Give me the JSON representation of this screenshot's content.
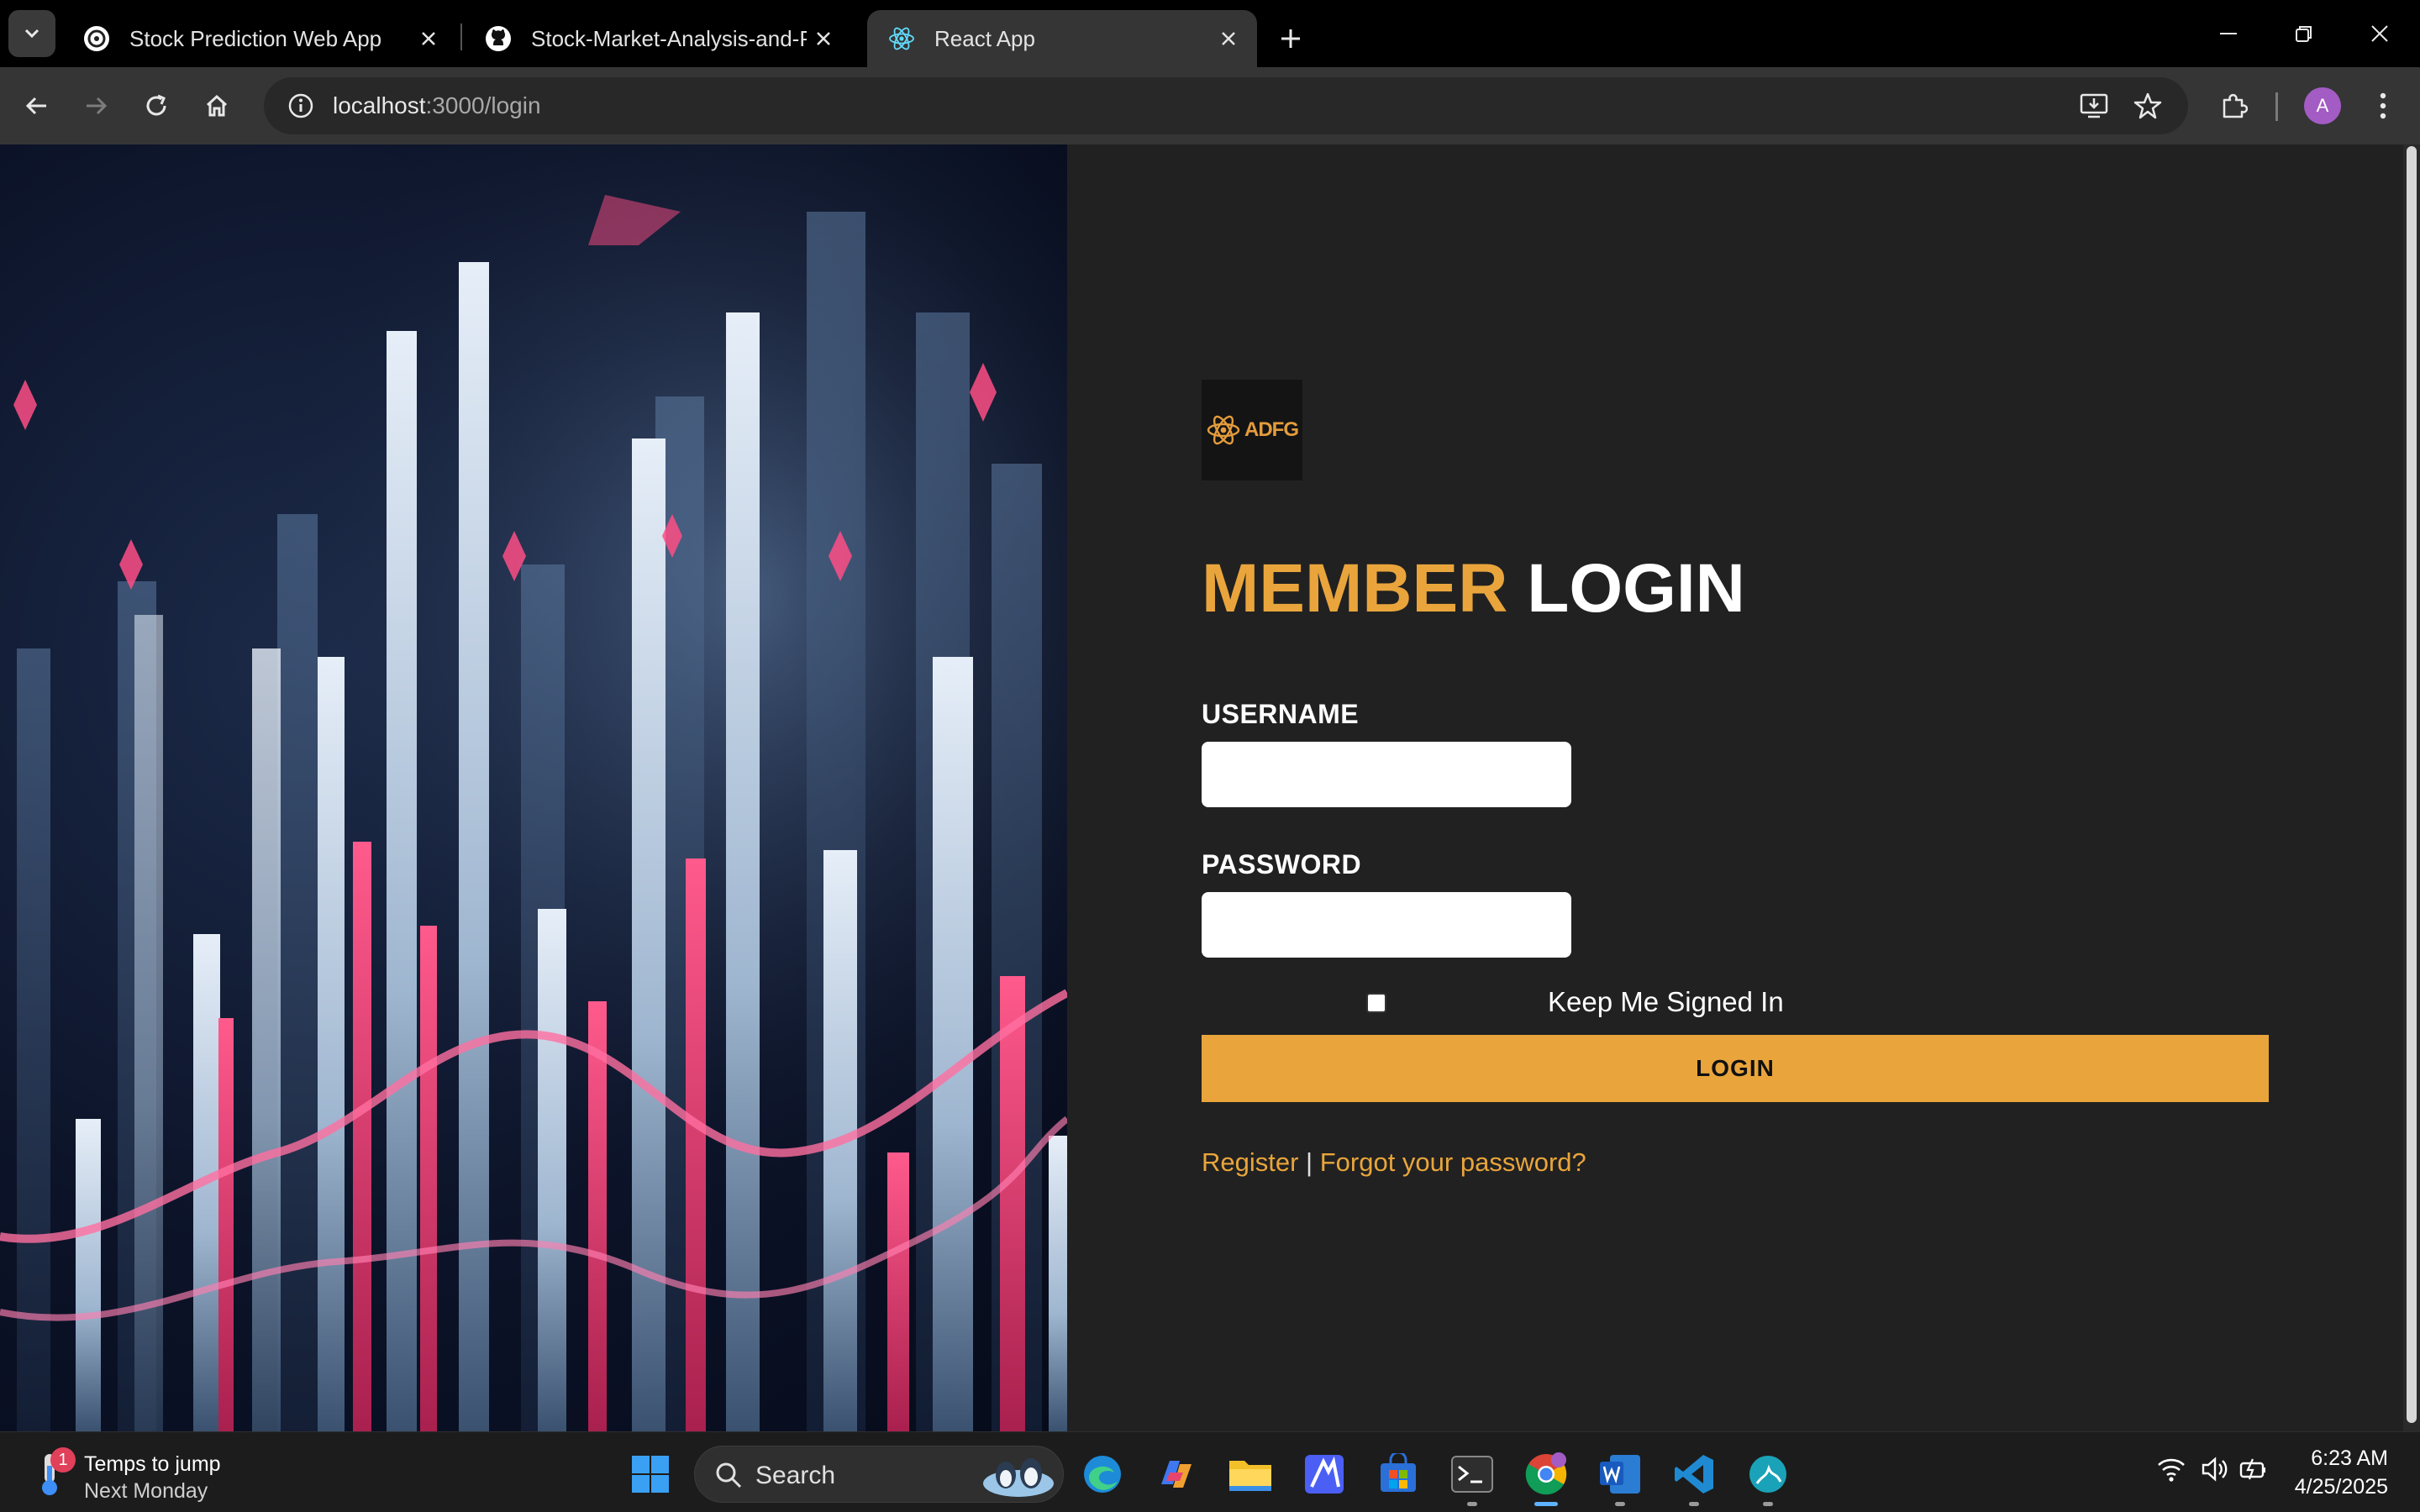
{
  "browser": {
    "tabs": [
      {
        "title": "Stock Prediction Web App",
        "icon": "chatgpt-icon"
      },
      {
        "title": "Stock-Market-Analysis-and-Pre",
        "icon": "github-icon"
      },
      {
        "title": "React App",
        "icon": "react-icon",
        "active": true
      }
    ],
    "address": {
      "host": "localhost",
      "path": ":3000/login"
    }
  },
  "profile": {
    "initial": "A"
  },
  "login": {
    "logo_text": "ADFG",
    "heading_word1": "MEMBER",
    "heading_word2": "LOGIN",
    "username_label": "USERNAME",
    "username_value": "",
    "password_label": "PASSWORD",
    "password_value": "",
    "remember_label": "Keep Me Signed In",
    "remember_checked": false,
    "login_button": "LOGIN",
    "register_link": "Register",
    "separator": " | ",
    "forgot_link": "Forgot your password?"
  },
  "colors": {
    "accent": "#e9a53c",
    "page_bg": "#212121",
    "chrome_bg": "#353535"
  },
  "taskbar": {
    "weather_badge": "1",
    "weather_line1": "Temps to jump",
    "weather_line2": "Next Monday",
    "search_label": "Search",
    "apps": [
      "windows-start-icon",
      "edge-icon",
      "copilot-icon",
      "file-explorer-icon",
      "app-icon",
      "microsoft-store-icon",
      "terminal-icon",
      "chrome-icon",
      "word-icon",
      "vscode-icon",
      "app-icon"
    ],
    "time": "6:23 AM",
    "date": "4/25/2025"
  }
}
